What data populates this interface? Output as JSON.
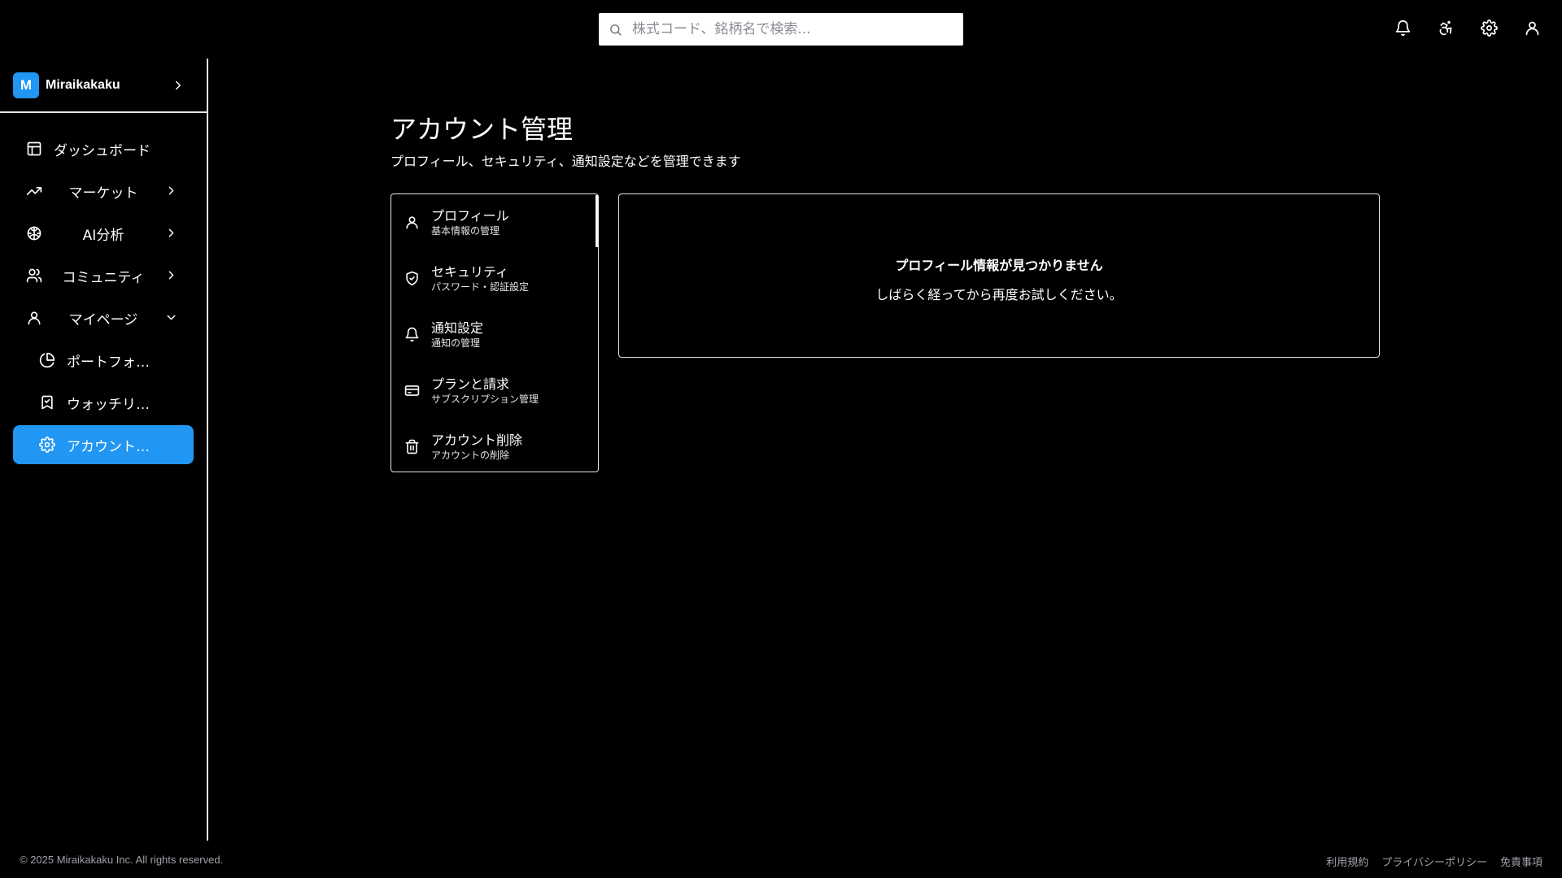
{
  "search": {
    "placeholder": "株式コード、銘柄名で検索..."
  },
  "header_icons": [
    "bell-icon",
    "accessibility-icon",
    "gear-icon",
    "user-icon"
  ],
  "brand": {
    "logo_letter": "M",
    "name": "Miraikakaku",
    "accent": "#2196f3"
  },
  "sidebar": {
    "items": [
      {
        "label": "ダッシュボード",
        "icon": "layout-icon"
      },
      {
        "label": "マーケット",
        "icon": "trending-up-icon"
      },
      {
        "label": "AI分析",
        "icon": "brain-icon"
      },
      {
        "label": "コミュニティ",
        "icon": "users-icon"
      },
      {
        "label": "マイページ",
        "icon": "user-icon"
      },
      {
        "label": "ポートフォリオ",
        "icon": "pie-chart-icon"
      },
      {
        "label": "ウォッチリスト",
        "icon": "bookmark-icon"
      },
      {
        "label": "アカウント設定",
        "icon": "gear-icon",
        "active": true
      }
    ]
  },
  "page": {
    "title": "アカウント管理",
    "subtitle": "プロフィール、セキュリティ、通知設定などを管理できます"
  },
  "tabs": [
    {
      "label": "プロフィール",
      "sublabel": "基本情報の管理",
      "icon": "user-icon"
    },
    {
      "label": "セキュリティ",
      "sublabel": "パスワード・認証設定",
      "icon": "shield-check-icon"
    },
    {
      "label": "通知設定",
      "sublabel": "通知の管理",
      "icon": "bell-icon"
    },
    {
      "label": "プランと請求",
      "sublabel": "サブスクリプション管理",
      "icon": "credit-card-icon"
    },
    {
      "label": "アカウント削除",
      "sublabel": "アカウントの削除",
      "icon": "trash-icon"
    }
  ],
  "panel": {
    "message": "プロフィール情報が見つかりません",
    "detail": "しばらく経ってから再度お試しください。"
  },
  "footer": {
    "copyright": "© 2025 Miraikakaku Inc. All rights reserved.",
    "links": [
      "利用規約",
      "プライバシーポリシー",
      "免責事項"
    ]
  }
}
